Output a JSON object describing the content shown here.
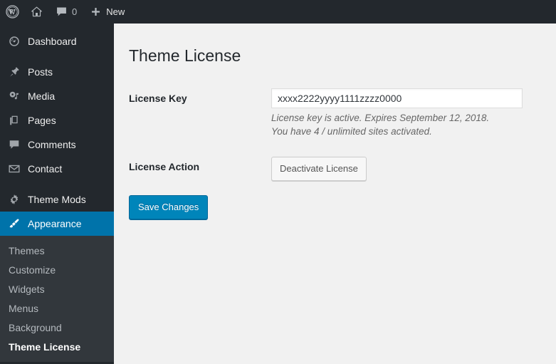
{
  "adminbar": {
    "logo_icon": "wordpress-logo-icon",
    "site_icon": "home-icon",
    "comments_icon": "comment-bubble-icon",
    "comments_count": "0",
    "new_icon": "plus-icon",
    "new_label": "New"
  },
  "sidebar": {
    "items": [
      {
        "label": "Dashboard",
        "icon": "dashboard-icon",
        "current": false
      },
      {
        "label": "Posts",
        "icon": "pushpin-icon",
        "current": false
      },
      {
        "label": "Media",
        "icon": "media-icon",
        "current": false
      },
      {
        "label": "Pages",
        "icon": "pages-icon",
        "current": false
      },
      {
        "label": "Comments",
        "icon": "comment-bubble-icon",
        "current": false
      },
      {
        "label": "Contact",
        "icon": "envelope-icon",
        "current": false
      },
      {
        "label": "Theme Mods",
        "icon": "gear-icon",
        "current": false
      },
      {
        "label": "Appearance",
        "icon": "paintbrush-icon",
        "current": true
      }
    ],
    "submenu": [
      {
        "label": "Themes",
        "current": false
      },
      {
        "label": "Customize",
        "current": false
      },
      {
        "label": "Widgets",
        "current": false
      },
      {
        "label": "Menus",
        "current": false
      },
      {
        "label": "Background",
        "current": false
      },
      {
        "label": "Theme License",
        "current": true
      }
    ]
  },
  "main": {
    "page_title": "Theme License",
    "fields": {
      "license_key_label": "License Key",
      "license_key_value": "xxxx2222yyyy1111zzzz0000",
      "license_key_placeholder": "",
      "description_line1": "License key is active. Expires September 12, 2018.",
      "description_line2": "You have 4 / unlimited sites activated.",
      "license_action_label": "License Action",
      "deactivate_button": "Deactivate License"
    },
    "save_button": "Save Changes"
  },
  "colors": {
    "admin_dark": "#23282d",
    "submenu_dark": "#32373c",
    "accent_blue": "#0073aa",
    "primary_button": "#0085ba",
    "content_bg": "#f1f1f1"
  }
}
